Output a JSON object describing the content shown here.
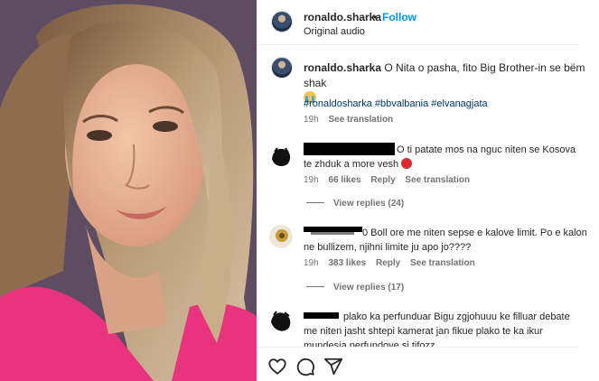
{
  "post": {
    "username": "ronaldo.sharka",
    "separator": "•",
    "follow_label": "Follow",
    "audio_label": "Original audio"
  },
  "caption": {
    "username": "ronaldo.sharka",
    "text": " O Nita o pasha, fito Big Brother-in se bëm shak ",
    "emoji": "loudly-crying-face",
    "hashtags": "#ronaldosharka #bbvalbania #elvanagjata",
    "time": "19h",
    "see_translation": "See translation"
  },
  "comments": [
    {
      "text_line1": "O ti patate mos na nguc niten se Kosova",
      "text_line2": "te zhduk a more vesh",
      "emoji": "angry-face",
      "time": "19h",
      "likes": "66 likes",
      "reply": "Reply",
      "see_translation": "See translation",
      "view_replies": "View replies (24)"
    },
    {
      "text_line1": "0 Boll ore me niten sepse e kalove limit. Po e kalon",
      "text_line2": "ne bullizem, njihni limite ju apo jo????",
      "time": "19h",
      "likes": "383 likes",
      "reply": "Reply",
      "see_translation": "See translation",
      "view_replies": "View replies (17)"
    },
    {
      "text_line1": "plako ka perfunduar Bigu zgjohuuu ke filluar debate",
      "text_line2": "me niten jasht shtepi kamerat jan fikue plako te ka ikur",
      "text_line3": "mundesia perfundove si tifozz"
    }
  ],
  "actions": {
    "like_icon": "heart-icon",
    "comment_icon": "comment-icon",
    "share_icon": "share-icon"
  },
  "colors": {
    "link_blue": "#0095f6",
    "hashtag_blue": "#00376b",
    "muted_gray": "#737373",
    "text": "#262626"
  }
}
